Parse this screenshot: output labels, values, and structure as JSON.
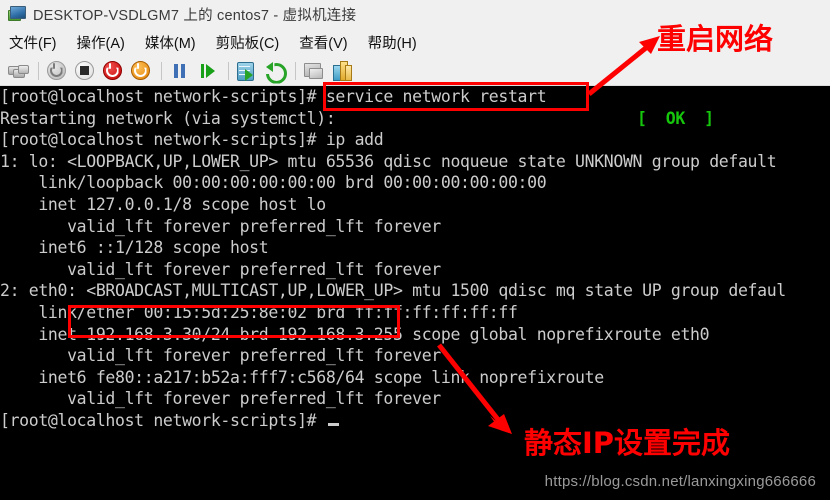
{
  "window": {
    "title": "DESKTOP-VSDLGM7 上的 centos7 - 虚拟机连接",
    "icon": "virtual-machine-connection-icon"
  },
  "menubar": {
    "items": [
      {
        "name": "file",
        "label": "文件(F)"
      },
      {
        "name": "action",
        "label": "操作(A)"
      },
      {
        "name": "media",
        "label": "媒体(M)"
      },
      {
        "name": "clipboard",
        "label": "剪贴板(C)"
      },
      {
        "name": "view",
        "label": "查看(V)"
      },
      {
        "name": "help",
        "label": "帮助(H)"
      }
    ]
  },
  "toolbar": {
    "buttons": [
      {
        "name": "ctrl-alt-del-icon",
        "tip": "Ctrl+Alt+Delete"
      },
      {
        "name": "start-icon",
        "tip": "启动"
      },
      {
        "name": "turn-off-icon",
        "tip": "关闭"
      },
      {
        "name": "shutdown-icon",
        "tip": "关机"
      },
      {
        "name": "reset-icon",
        "tip": "重置"
      },
      {
        "name": "pause-icon",
        "tip": "暂停"
      },
      {
        "name": "resume-icon",
        "tip": "继续"
      },
      {
        "name": "checkpoint-icon",
        "tip": "检查点"
      },
      {
        "name": "revert-icon",
        "tip": "还原"
      },
      {
        "name": "enhanced-session-icon",
        "tip": "增强会话"
      },
      {
        "name": "settings-icon",
        "tip": "设置"
      }
    ]
  },
  "terminal": {
    "prompt_user": "root",
    "prompt_host": "localhost",
    "prompt_dir": "network-scripts",
    "lines": [
      {
        "id": "l01",
        "text": "[root@localhost network-scripts]# service network restart"
      },
      {
        "id": "l02",
        "text": "Restarting network (via systemctl):",
        "status": "[  OK  ]",
        "status_col": 637
      },
      {
        "id": "l03",
        "text": "[root@localhost network-scripts]# ip add"
      },
      {
        "id": "l04",
        "text": "1: lo: <LOOPBACK,UP,LOWER_UP> mtu 65536 qdisc noqueue state UNKNOWN group default"
      },
      {
        "id": "l05",
        "text": "    link/loopback 00:00:00:00:00:00 brd 00:00:00:00:00:00"
      },
      {
        "id": "l06",
        "text": "    inet 127.0.0.1/8 scope host lo"
      },
      {
        "id": "l07",
        "text": "       valid_lft forever preferred_lft forever"
      },
      {
        "id": "l08",
        "text": "    inet6 ::1/128 scope host"
      },
      {
        "id": "l09",
        "text": "       valid_lft forever preferred_lft forever"
      },
      {
        "id": "l10",
        "text": "2: eth0: <BROADCAST,MULTICAST,UP,LOWER_UP> mtu 1500 qdisc mq state UP group defaul"
      },
      {
        "id": "l11",
        "text": "    link/ether 00:15:5d:25:8e:02 brd ff:ff:ff:ff:ff:ff"
      },
      {
        "id": "l12",
        "text": "    inet 192.168.3.30/24 brd 192.168.3.255 scope global noprefixroute eth0"
      },
      {
        "id": "l13",
        "text": "       valid_lft forever preferred_lft forever"
      },
      {
        "id": "l14",
        "text": "    inet6 fe80::a217:b52a:fff7:c568/64 scope link noprefixroute"
      },
      {
        "id": "l15",
        "text": "       valid_lft forever preferred_lft forever"
      },
      {
        "id": "l16",
        "text": "[root@localhost network-scripts]# ",
        "cursor": true
      }
    ]
  },
  "annotations": {
    "restart_label": "重启网络",
    "static_ip_label": "静态IP设置完成",
    "highlight_command": "service network restart",
    "highlight_ip": "inet 192.168.3.30/24 brd 192.168.3.2",
    "color": "#fe0000"
  },
  "watermark": {
    "url": "https://blog.csdn.net/lanxingxing666666"
  }
}
